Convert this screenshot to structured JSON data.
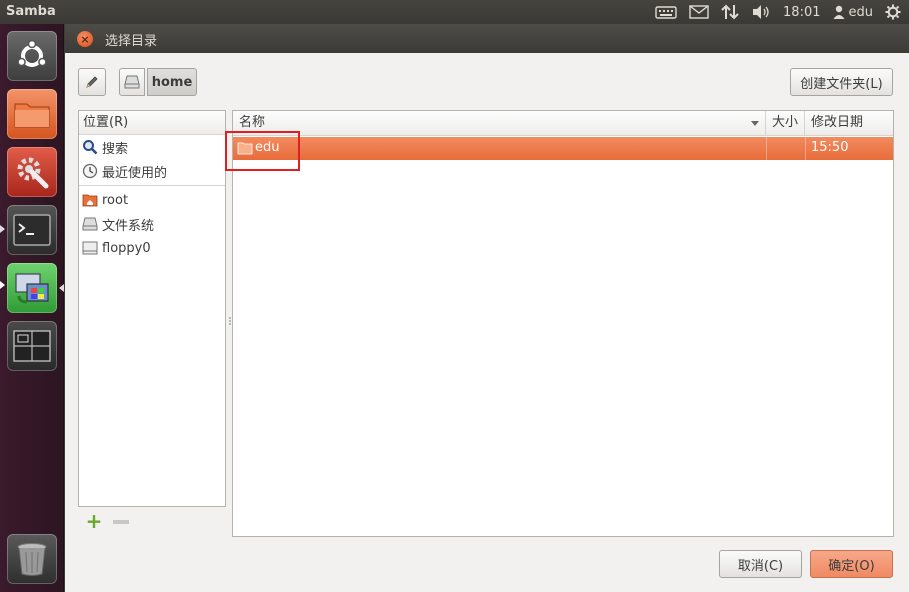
{
  "top_panel": {
    "app_title": "Samba",
    "time": "18:01",
    "user": "edu"
  },
  "launcher": {
    "items": [
      "ubuntu-dash",
      "files",
      "system-settings",
      "terminal",
      "remote-desktop",
      "workspace-switcher",
      "trash"
    ]
  },
  "dialog": {
    "title": "选择目录",
    "path_bar": {
      "current": "home"
    },
    "create_folder_label": "创建文件夹(L)",
    "places": {
      "header": "位置(R)",
      "items": [
        {
          "label": "搜索"
        },
        {
          "label": "最近使用的"
        },
        {
          "label": "root"
        },
        {
          "label": "文件系统"
        },
        {
          "label": "floppy0"
        }
      ]
    },
    "files": {
      "columns": {
        "name": "名称",
        "size": "大小",
        "modified": "修改日期"
      },
      "rows": [
        {
          "name": "edu",
          "size": "",
          "modified": "15:50"
        }
      ]
    },
    "cancel_label": "取消(C)",
    "ok_label": "确定(O)"
  },
  "colors": {
    "selection": "#e86c3a",
    "accent_button": "#f08a62",
    "highlight_box": "#e02020"
  }
}
